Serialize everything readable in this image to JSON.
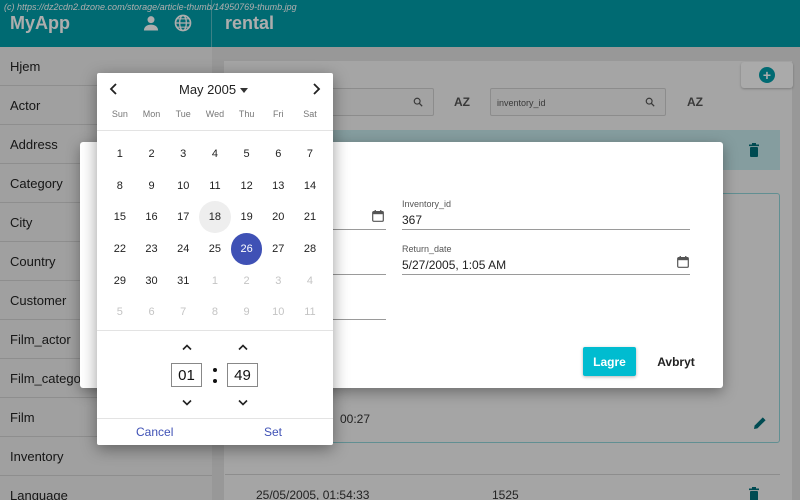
{
  "watermark": "(c) https://dz2cdn2.dzone.com/storage/article-thumb/14950769-thumb.jpg",
  "app": {
    "title": "MyApp",
    "page_title": "rental"
  },
  "sidebar": {
    "items": [
      {
        "label": "Hjem"
      },
      {
        "label": "Actor"
      },
      {
        "label": "Address"
      },
      {
        "label": "Category"
      },
      {
        "label": "City"
      },
      {
        "label": "Country"
      },
      {
        "label": "Customer"
      },
      {
        "label": "Film_actor"
      },
      {
        "label": "Film_category"
      },
      {
        "label": "Film"
      },
      {
        "label": "Inventory"
      },
      {
        "label": "Language"
      }
    ]
  },
  "main": {
    "filter2_label": "inventory_id",
    "sort_label": "AZ",
    "row_partial_time": "00:27",
    "last_row": {
      "date": "25/05/2005, 01:54:33",
      "id": "1525"
    }
  },
  "dialog": {
    "inventory_id": {
      "label": "Inventory_id",
      "value": "367"
    },
    "return_date": {
      "label": "Return_date",
      "value": "5/27/2005, 1:05 AM"
    },
    "save_label": "Lagre",
    "cancel_label": "Avbryt"
  },
  "picker": {
    "month_label": "May 2005",
    "weekdays": [
      "Sun",
      "Mon",
      "Tue",
      "Wed",
      "Thu",
      "Fri",
      "Sat"
    ],
    "weeks": [
      [
        "1",
        "2",
        "3",
        "4",
        "5",
        "6",
        "7"
      ],
      [
        "8",
        "9",
        "10",
        "11",
        "12",
        "13",
        "14"
      ],
      [
        "15",
        "16",
        "17",
        "18",
        "19",
        "20",
        "21"
      ],
      [
        "22",
        "23",
        "24",
        "25",
        "26",
        "27",
        "28"
      ],
      [
        "29",
        "30",
        "31",
        "1",
        "2",
        "3",
        "4"
      ],
      [
        "5",
        "6",
        "7",
        "8",
        "9",
        "10",
        "11"
      ]
    ],
    "selected_day": "26",
    "today_day": "18",
    "hour": "01",
    "minute": "49",
    "cancel_label": "Cancel",
    "set_label": "Set"
  },
  "colors": {
    "primary": "#009ca8",
    "accent": "#00bcd0",
    "picker_accent": "#3f51b5"
  },
  "icons": [
    "person-icon",
    "globe-icon",
    "plus-icon",
    "search-icon",
    "sort-az-icon",
    "trash-icon",
    "pencil-icon",
    "calendar-icon",
    "chevron-left-icon",
    "chevron-right-icon",
    "caret-down-icon",
    "chevron-up-icon",
    "chevron-down-icon"
  ]
}
